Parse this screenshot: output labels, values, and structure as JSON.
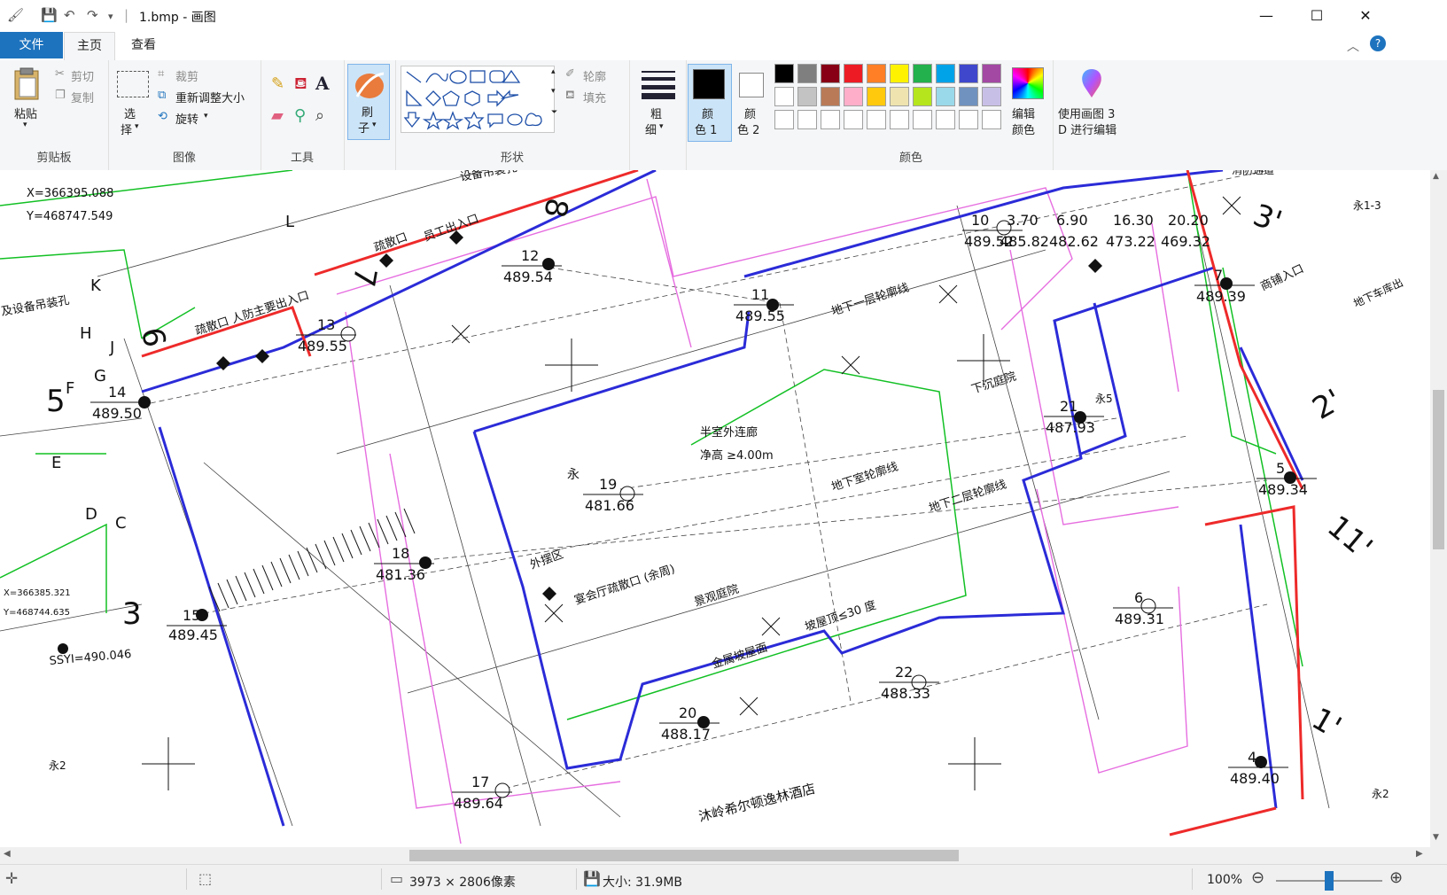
{
  "window": {
    "title": "1.bmp - 画图",
    "minimize": "—",
    "maximize": "☐",
    "close": "✕"
  },
  "menu": {
    "file": "文件",
    "tabs": [
      "主页",
      "查看"
    ]
  },
  "ribbon": {
    "clipboard": {
      "label": "剪贴板",
      "paste": "粘贴",
      "cut": "剪切",
      "copy": "复制"
    },
    "image": {
      "label": "图像",
      "select": "选",
      "select2": "择",
      "crop": "裁剪",
      "resize": "重新调整大小",
      "rotate": "旋转"
    },
    "tools": {
      "label": "工具"
    },
    "brushes": {
      "line1": "刷",
      "line2": "子"
    },
    "shapes": {
      "label": "形状",
      "outline": "轮廓",
      "fill": "填充"
    },
    "size": {
      "line1": "粗",
      "line2": "细"
    },
    "color1": {
      "line1": "颜",
      "line2": "色 1",
      "value": "#000000"
    },
    "color2": {
      "line1": "颜",
      "line2": "色 2",
      "value": "#ffffff"
    },
    "colors": {
      "label": "颜色",
      "edit1": "编辑",
      "edit2": "颜色",
      "palette_row1": [
        "#000000",
        "#7f7f7f",
        "#880015",
        "#ed1c24",
        "#ff7f27",
        "#fff200",
        "#22b14c",
        "#00a2e8",
        "#3f48cc",
        "#a349a4"
      ],
      "palette_row2": [
        "#ffffff",
        "#c3c3c3",
        "#b97a57",
        "#ffaec9",
        "#ffc90e",
        "#efe4b0",
        "#b5e61d",
        "#99d9ea",
        "#7092be",
        "#c8bfe7"
      ]
    },
    "paint3d": {
      "line1": "使用画图 3",
      "line2": "D 进行编辑"
    }
  },
  "canvas": {
    "labels": {
      "coord_x1": "X=366395.088",
      "coord_y1": "Y=468747.549",
      "coord_x2": "X=366385.321",
      "coord_y2": "Y=468744.635",
      "ssyi": "SSYI=490.046",
      "hoist": "设备吊装孔",
      "hoist2": "及设备吊装孔",
      "staff_entry": "员工出入口",
      "exit1": "疏散口",
      "civil_entry": "疏散口 人防主要出入口",
      "sunk_plaza": "下沉庭院",
      "semi_corridor": "半室外连廊",
      "clear_height": "净高 ≥4.00m",
      "basement1": "地下一层轮廓线",
      "basement_b": "地下室轮廓线",
      "basement2": "地下二层轮廓线",
      "outer_area": "外摆区",
      "banquet": "宴会厅疏散口 (余周)",
      "landscape": "景观庭院",
      "slope": "坡屋顶≤30 度",
      "metal_roof": "金属坡屋面",
      "hotel": "沐岭希尔顿逸林酒店",
      "shop_entry": "商铺入口",
      "garage": "地下车库出",
      "yong": "永",
      "yong13": "永1-3",
      "yong2": "永2",
      "yong5": "永5",
      "fire_road": "消防通道"
    },
    "points": [
      {
        "n": "10",
        "v": "489.52"
      },
      {
        "n": "11",
        "v": "489.55"
      },
      {
        "n": "12",
        "v": "489.54"
      },
      {
        "n": "13",
        "v": "489.55"
      },
      {
        "n": "14",
        "v": "489.50"
      },
      {
        "n": "15",
        "v": "489.45"
      },
      {
        "n": "17",
        "v": "489.64"
      },
      {
        "n": "18",
        "v": "481.36"
      },
      {
        "n": "19",
        "v": "481.66"
      },
      {
        "n": "20",
        "v": "488.17"
      },
      {
        "n": "21",
        "v": "487.93"
      },
      {
        "n": "22",
        "v": "488.33"
      },
      {
        "n": "4",
        "v": "489.40"
      },
      {
        "n": "5",
        "v": "489.34"
      },
      {
        "n": "6",
        "v": "489.31"
      },
      {
        "n": "7",
        "v": "489.39"
      }
    ],
    "dims_top": [
      "3.70",
      "6.90",
      "16.30",
      "20.20"
    ],
    "dims_bottom": [
      "485.82",
      "482.62",
      "473.22",
      "469.32"
    ],
    "axes": [
      "5",
      "6",
      "7",
      "8",
      "3",
      "2'",
      "3'",
      "11'",
      "1'"
    ],
    "letters": [
      "L",
      "K",
      "H",
      "J",
      "G",
      "F",
      "E",
      "D",
      "C"
    ]
  },
  "status": {
    "dimensions": "3973 × 2806像素",
    "size": "大小: 31.9MB",
    "zoom": "100%",
    "zoom_fraction": 0.5
  }
}
